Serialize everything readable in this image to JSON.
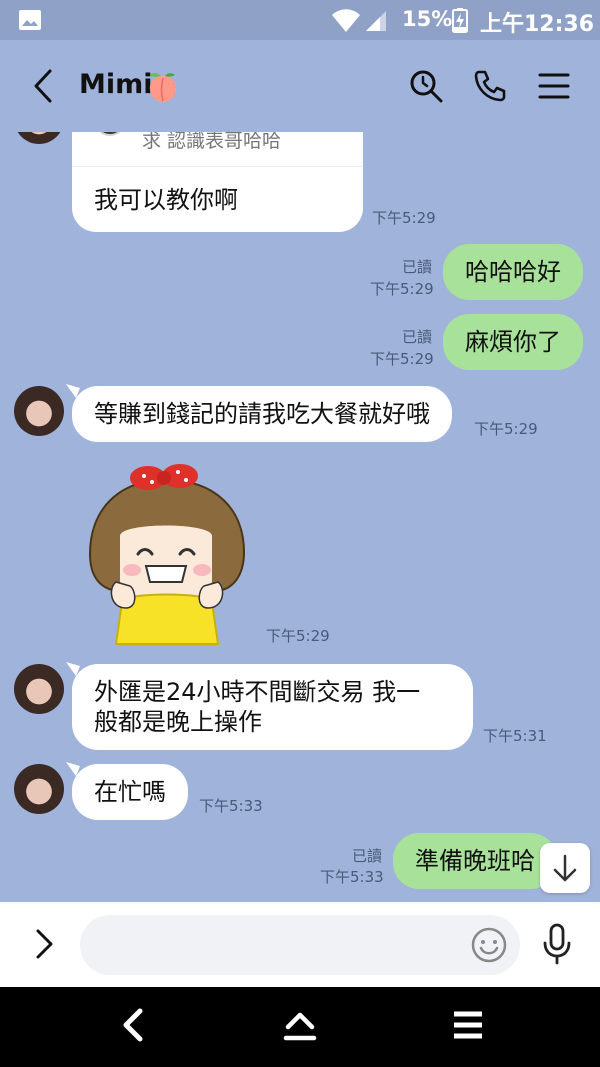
{
  "status_bar": {
    "battery_percent": "15%",
    "clock": "上午12:36",
    "icons": [
      "gallery-icon",
      "wifi-icon",
      "signal-icon",
      "battery-charging-icon"
    ]
  },
  "header": {
    "title": "Mimi",
    "title_emoji": "peach",
    "icons": [
      "back-icon",
      "search-icon",
      "phone-icon",
      "menu-icon"
    ]
  },
  "messages": [
    {
      "type": "reply_card",
      "direction": "in",
      "quoted_text": "求 認識表哥哈哈",
      "text": "我可以教你啊",
      "time": "下午5:29"
    },
    {
      "type": "text",
      "direction": "out",
      "read": "已讀",
      "text": "哈哈哈好",
      "time": "下午5:29"
    },
    {
      "type": "text",
      "direction": "out",
      "read": "已讀",
      "text": "麻煩你了",
      "time": "下午5:29"
    },
    {
      "type": "text",
      "direction": "in",
      "text": "等賺到錢記的請我吃大餐就好哦",
      "time": "下午5:29"
    },
    {
      "type": "sticker",
      "direction": "in",
      "time": "下午5:29"
    },
    {
      "type": "text",
      "direction": "in",
      "lines": [
        "外匯是24小時不間斷交易 我一",
        "般都是晚上操作"
      ],
      "time": "下午5:31"
    },
    {
      "type": "text",
      "direction": "in",
      "text": "在忙嗎",
      "time": "下午5:33"
    },
    {
      "type": "text",
      "direction": "out",
      "read": "已讀",
      "text": "準備晚班哈",
      "time": "下午5:33"
    }
  ],
  "input_bar": {
    "placeholder": "",
    "icons": [
      "expand-icon",
      "emoji-icon",
      "microphone-icon"
    ]
  },
  "colors": {
    "chat_background": "#9fb3db",
    "outgoing_bubble": "#a7e19a",
    "incoming_bubble": "#ffffff",
    "status_bar": "#8fa1c6"
  }
}
